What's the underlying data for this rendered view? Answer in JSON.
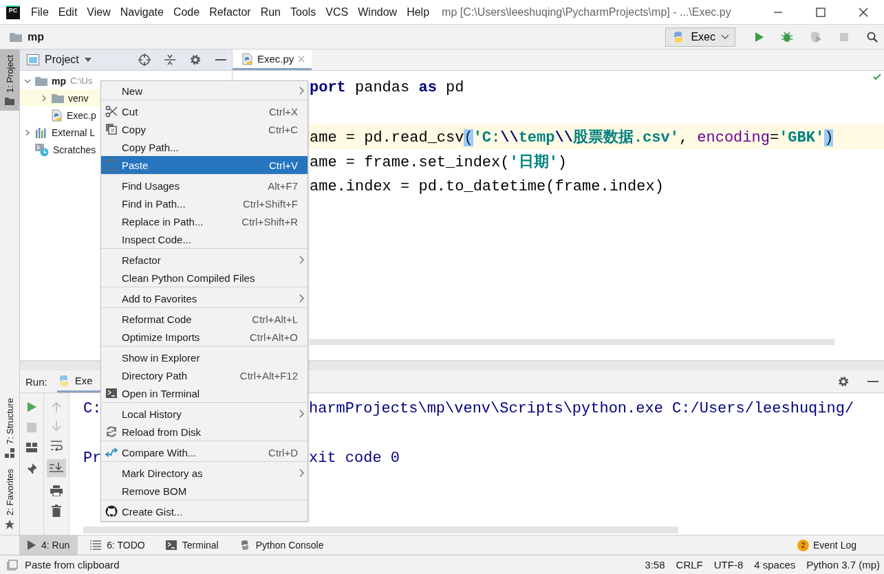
{
  "title_bar": {
    "logo": "PC",
    "menu": [
      "File",
      "Edit",
      "View",
      "Navigate",
      "Code",
      "Refactor",
      "Run",
      "Tools",
      "VCS",
      "Window",
      "Help"
    ],
    "title": "mp [C:\\Users\\leeshuqing\\PycharmProjects\\mp] - ...\\Exec.py"
  },
  "nav_bar": {
    "project": "mp",
    "run_config": "Exec"
  },
  "side_tabs": [
    {
      "label": "1: Project",
      "selected": true
    },
    {
      "label": "7: Structure",
      "selected": false
    },
    {
      "label": "2: Favorites",
      "selected": false
    }
  ],
  "project_panel": {
    "title": "Project",
    "tree": [
      {
        "label": "mp",
        "path": "C:\\Us",
        "kind": "folder",
        "expanded": true,
        "selected": false,
        "children": [
          {
            "label": "venv",
            "kind": "folder",
            "expanded": false,
            "selected": true
          },
          {
            "label": "Exec.p",
            "kind": "python",
            "selected": false
          }
        ]
      },
      {
        "label": "External L",
        "kind": "libraries",
        "expanded": false,
        "selected": false
      },
      {
        "label": "Scratches",
        "kind": "scratches",
        "selected": false
      }
    ]
  },
  "editor": {
    "tabs": [
      {
        "label": "Exec.py",
        "selected": true
      }
    ],
    "lines": [
      {
        "current": false,
        "segments": [
          {
            "kind": "keyword",
            "text": "port"
          },
          {
            "kind": "plain",
            "text": " pandas "
          },
          {
            "kind": "keyword",
            "text": "as"
          },
          {
            "kind": "plain",
            "text": " pd"
          }
        ]
      },
      {
        "current": false
      },
      {
        "current": true,
        "segments": [
          {
            "kind": "plain",
            "text": "ame = pd.read_csv"
          },
          {
            "kind": "brace",
            "text": "("
          },
          {
            "kind": "string",
            "text": "'C:"
          },
          {
            "kind": "escape",
            "text": "\\\\"
          },
          {
            "kind": "string",
            "text": "temp"
          },
          {
            "kind": "escape",
            "text": "\\\\"
          },
          {
            "kind": "string",
            "text": "股票数据.csv'"
          },
          {
            "kind": "plain",
            "text": ", "
          },
          {
            "kind": "param",
            "text": "encoding"
          },
          {
            "kind": "plain",
            "text": "="
          },
          {
            "kind": "string",
            "text": "'GBK'"
          },
          {
            "kind": "brace",
            "text": ")"
          }
        ]
      },
      {
        "current": false,
        "segments": [
          {
            "kind": "plain",
            "text": "ame = frame.set_index("
          },
          {
            "kind": "string",
            "text": "'日期'"
          },
          {
            "kind": "plain",
            "text": ")"
          }
        ]
      },
      {
        "current": false,
        "segments": [
          {
            "kind": "plain",
            "text": "ame.index = pd.to_datetime(frame.index)"
          }
        ]
      }
    ]
  },
  "run_panel": {
    "label": "Run:",
    "tab": "Exe",
    "lines": [
      {
        "start": "C:",
        "rest": "harmProjects\\mp\\venv\\Scripts\\python.exe C:/Users/leeshuqing/"
      },
      {
        "start": "Pr",
        "rest": "xit code 0"
      }
    ]
  },
  "context_menu": {
    "groups": [
      [
        {
          "label": "New",
          "submenu": true,
          "selected": false
        }
      ],
      [
        {
          "label": "Cut",
          "shortcut": "Ctrl+X",
          "submenu": false,
          "selected": false
        },
        {
          "label": "Copy",
          "shortcut": "Ctrl+C",
          "submenu": false,
          "selected": false
        },
        {
          "label": "Copy Path...",
          "submenu": false,
          "selected": false
        },
        {
          "label": "Paste",
          "shortcut": "Ctrl+V",
          "submenu": false,
          "selected": true
        }
      ],
      [
        {
          "label": "Find Usages",
          "shortcut": "Alt+F7",
          "submenu": false,
          "selected": false
        },
        {
          "label": "Find in Path...",
          "shortcut": "Ctrl+Shift+F",
          "submenu": false,
          "selected": false
        },
        {
          "label": "Replace in Path...",
          "shortcut": "Ctrl+Shift+R",
          "submenu": false,
          "selected": false
        },
        {
          "label": "Inspect Code...",
          "submenu": false,
          "selected": false
        }
      ],
      [
        {
          "label": "Refactor",
          "submenu": true,
          "selected": false
        },
        {
          "label": "Clean Python Compiled Files",
          "submenu": false,
          "selected": false
        }
      ],
      [
        {
          "label": "Add to Favorites",
          "submenu": true,
          "selected": false
        }
      ],
      [
        {
          "label": "Reformat Code",
          "shortcut": "Ctrl+Alt+L",
          "submenu": false,
          "selected": false
        },
        {
          "label": "Optimize Imports",
          "shortcut": "Ctrl+Alt+O",
          "submenu": false,
          "selected": false
        }
      ],
      [
        {
          "label": "Show in Explorer",
          "submenu": false,
          "selected": false
        },
        {
          "label": "Directory Path",
          "shortcut": "Ctrl+Alt+F12",
          "submenu": false,
          "selected": false
        },
        {
          "label": "Open in Terminal",
          "submenu": false,
          "selected": false
        }
      ],
      [
        {
          "label": "Local History",
          "submenu": true,
          "selected": false
        },
        {
          "label": "Reload from Disk",
          "submenu": false,
          "selected": false
        }
      ],
      [
        {
          "label": "Compare With...",
          "shortcut": "Ctrl+D",
          "submenu": false,
          "selected": false
        }
      ],
      [
        {
          "label": "Mark Directory as",
          "submenu": true,
          "selected": false
        },
        {
          "label": "Remove BOM",
          "submenu": false,
          "selected": false
        }
      ],
      [
        {
          "label": "Create Gist...",
          "submenu": false,
          "selected": false
        }
      ]
    ]
  },
  "tool_window_bar": {
    "tabs": [
      {
        "label": "4: Run",
        "selected": true,
        "kind": "run"
      },
      {
        "label": "6: TODO",
        "selected": false,
        "kind": "todo"
      },
      {
        "label": "Terminal",
        "selected": false,
        "kind": "terminal"
      },
      {
        "label": "Python Console",
        "selected": false,
        "kind": "python"
      }
    ],
    "event_log": {
      "badge": "2",
      "label": "Event Log"
    }
  },
  "status_bar": {
    "message": "Paste from clipboard",
    "items": [
      "3:58",
      "CRLF",
      "UTF-8",
      "4 spaces",
      "Python 3.7 (mp)"
    ]
  }
}
